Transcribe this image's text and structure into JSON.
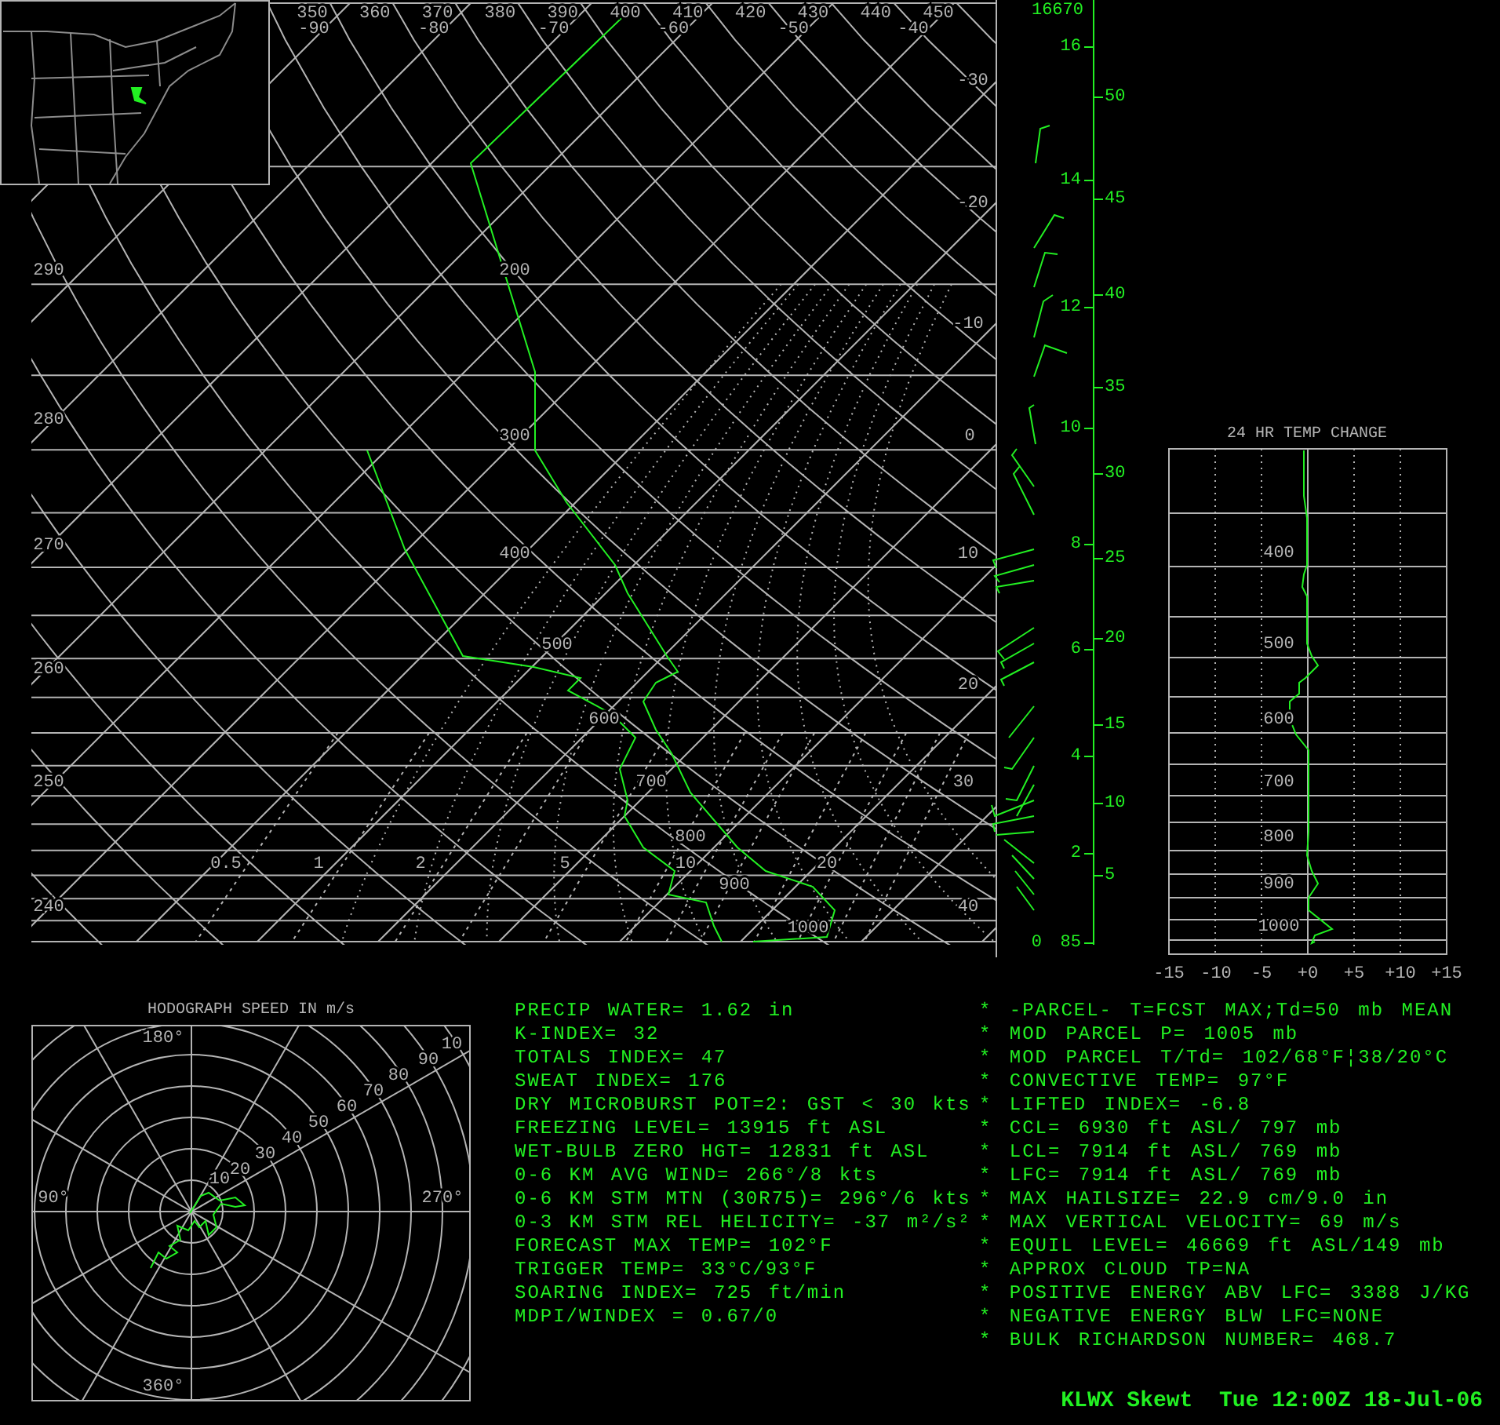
{
  "skewt": {
    "top_theta_labels": [
      "350",
      "360",
      "370",
      "380",
      "390",
      "400",
      "410",
      "420",
      "430",
      "440",
      "450"
    ],
    "top_temperature_labels": [
      "-90",
      "-80",
      "-70",
      "-60",
      "-50",
      "-40"
    ],
    "left_theta_labels": [
      "290",
      "280",
      "270",
      "260",
      "250",
      "240"
    ],
    "pressure_labels": [
      "200",
      "300",
      "400",
      "500",
      "600",
      "700",
      "800",
      "900",
      "1000"
    ],
    "temperature_labels": [
      "-30",
      "-20",
      "-10",
      "0",
      "10",
      "20",
      "30",
      "40"
    ],
    "mixing_ratio_labels": [
      "0.5",
      "1",
      "2",
      "5",
      "10",
      "20"
    ],
    "height_km_labels": [
      "16",
      "14",
      "12",
      "10",
      "8",
      "6",
      "4",
      "2",
      "0"
    ],
    "height_kft_labels": [
      "50",
      "45",
      "40",
      "35",
      "30",
      "25",
      "20",
      "15",
      "10",
      "5"
    ],
    "axis_top_label": "16670",
    "axis_bottom_label": "85"
  },
  "temp_change": {
    "title": "24 HR TEMP CHANGE",
    "pressure_labels": [
      "400",
      "500",
      "600",
      "700",
      "800",
      "900",
      "1000"
    ],
    "x_tick_labels": [
      "-15",
      "-10",
      "-5",
      "+0",
      "+5",
      "+10",
      "+15"
    ]
  },
  "hodograph": {
    "title": "HODOGRAPH SPEED IN m/s",
    "direction_labels": [
      "180°",
      "90°",
      "270°",
      "360°"
    ],
    "speed_labels": [
      "10",
      "20",
      "30",
      "40",
      "50",
      "60",
      "70",
      "80",
      "90",
      "10"
    ]
  },
  "indices": [
    "PRECIP WATER= 1.62 in",
    "K-INDEX= 32",
    "TOTALS INDEX= 47",
    "SWEAT INDEX= 176",
    "DRY MICROBURST POT=2: GST < 30 kts",
    "FREEZING LEVEL= 13915 ft ASL",
    "WET-BULB ZERO HGT= 12831 ft ASL",
    "0-6 KM AVG WIND= 266°/8 kts",
    "0-6 KM STM MTN (30R75)= 296°/6 kts",
    "0-3 KM STM REL HELICITY= -37 m²/s²",
    "FORECAST MAX TEMP= 102°F",
    "TRIGGER TEMP= 33°C/93°F",
    "SOARING INDEX= 725 ft/min",
    "MDPI/WINDEX = 0.67/0"
  ],
  "parcel": [
    "* -PARCEL- T=FCST MAX;Td=50 mb MEAN",
    "* MOD PARCEL P= 1005 mb",
    "* MOD PARCEL T/Td= 102/68°F¦38/20°C",
    "* CONVECTIVE TEMP= 97°F",
    "* LIFTED INDEX= -6.8",
    "* CCL= 6930 ft ASL/ 797 mb",
    "* LCL= 7914 ft ASL/ 769 mb",
    "* LFC= 7914 ft ASL/ 769 mb",
    "* MAX HAILSIZE= 22.9 cm/9.0 in",
    "* MAX VERTICAL VELOCITY= 69 m/s",
    "* EQUIL LEVEL= 46669 ft ASL/149 mb",
    "* APPROX CLOUD TP=NA",
    "* POSITIVE ENERGY ABV LFC= 3388 J/KG",
    "* NEGATIVE ENERGY BLW LFC=NONE",
    "* BULK RICHARDSON NUMBER= 468.7"
  ],
  "footer": "KLWX Skewt  Tue 12:00Z 18-Jul-06"
}
